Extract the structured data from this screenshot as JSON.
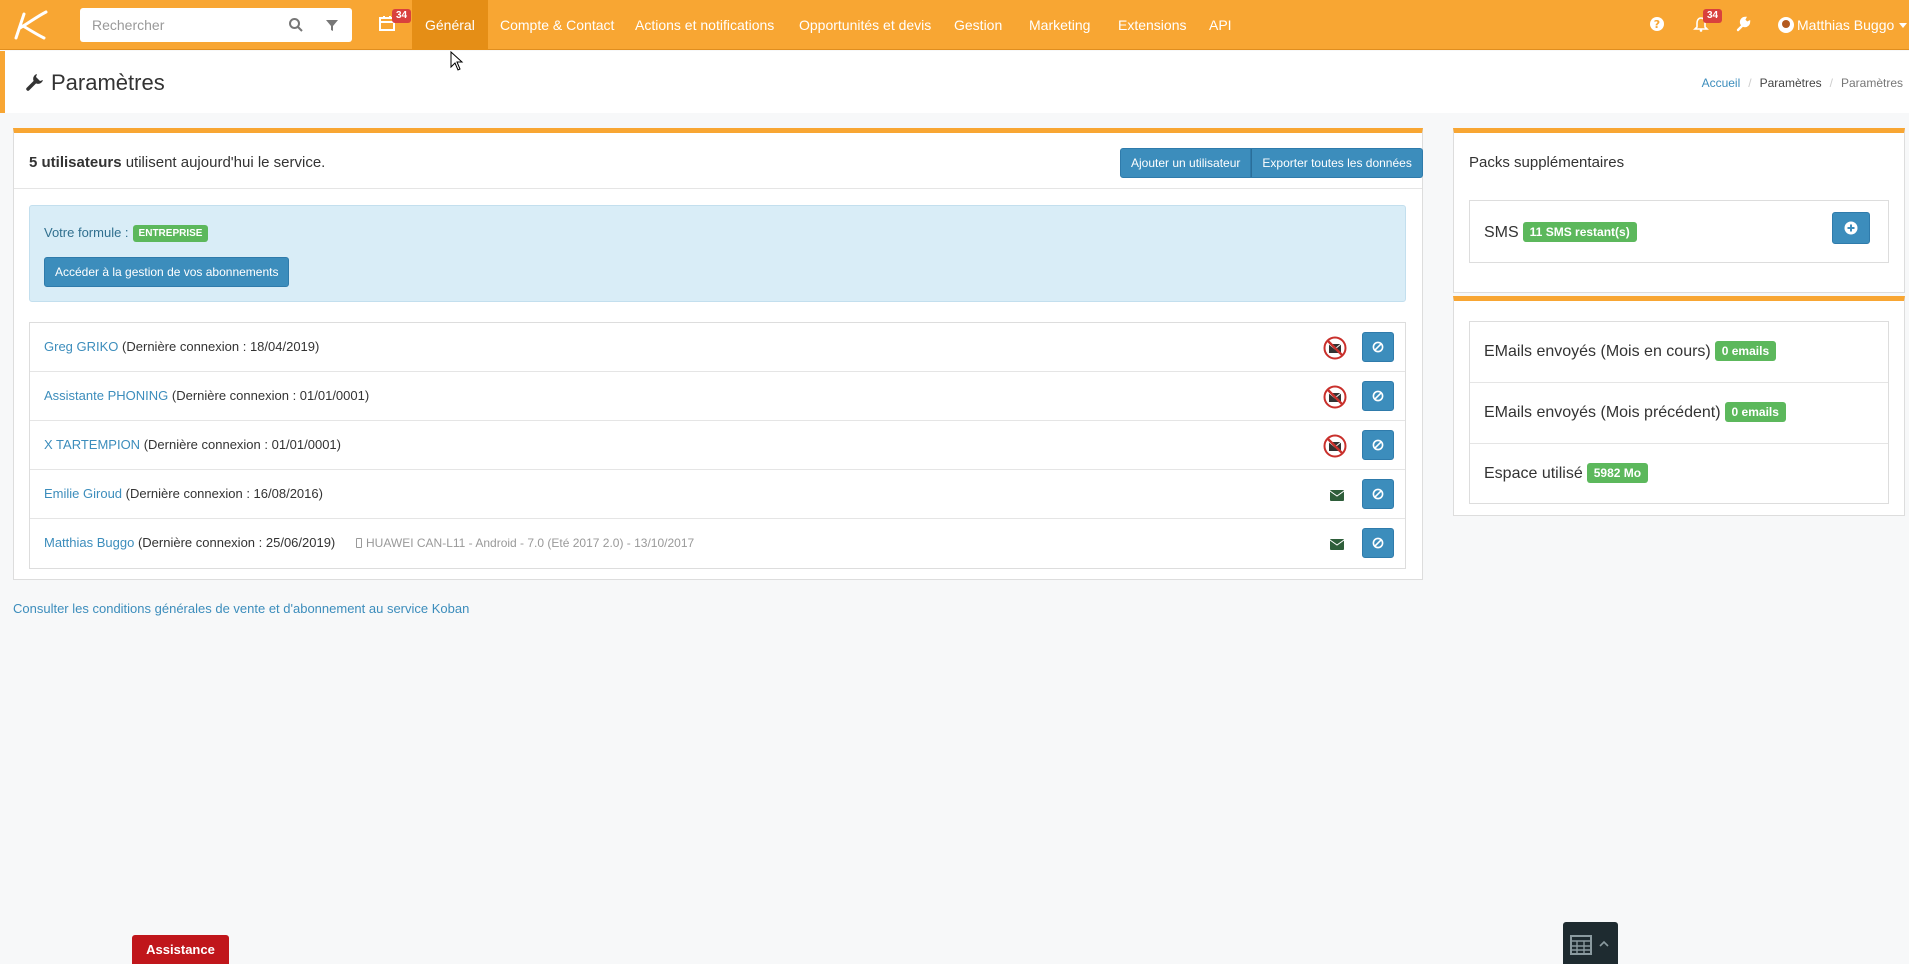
{
  "search": {
    "placeholder": "Rechercher"
  },
  "nav": {
    "calendar_badge": "34",
    "items": [
      "Général",
      "Compte & Contact",
      "Actions et notifications",
      "Opportunités et devis",
      "Gestion",
      "Marketing",
      "Extensions",
      "API"
    ],
    "notifications_badge": "34",
    "user_name": "Matthias Buggo"
  },
  "page": {
    "title": "Paramètres",
    "breadcrumb": [
      "Accueil",
      "Paramètres",
      "Paramètres"
    ]
  },
  "users_panel": {
    "count_bold": "5 utilisateurs",
    "count_rest": " utilisent aujourd'hui le service.",
    "add_user_label": "Ajouter un utilisateur",
    "export_label": "Exporter toutes les données",
    "formule_label": "Votre formule :",
    "formule_value": "ENTREPRISE",
    "subscriptions_label": "Accéder à la gestion de vos abonnements",
    "users": [
      {
        "name": "Greg GRIKO",
        "last_login": "(Dernière connexion : 18/04/2019)",
        "device": "",
        "mail_status": "disabled"
      },
      {
        "name": "Assistante PHONING",
        "last_login": "(Dernière connexion : 01/01/0001)",
        "device": "",
        "mail_status": "disabled"
      },
      {
        "name": "X TARTEMPION",
        "last_login": "(Dernière connexion : 01/01/0001)",
        "device": "",
        "mail_status": "disabled"
      },
      {
        "name": "Emilie Giroud",
        "last_login": "(Dernière connexion : 16/08/2016)",
        "device": "",
        "mail_status": "enabled"
      },
      {
        "name": "Matthias Buggo",
        "last_login": "(Dernière connexion : 25/06/2019)",
        "device": "HUAWEI CAN-L11 - Android - 7.0 (Eté 2017 2.0) - 13/10/2017",
        "mail_status": "enabled"
      }
    ]
  },
  "cgv_link": "Consulter les conditions générales de vente et d'abonnement au service Koban",
  "packs_panel": {
    "title": "Packs supplémentaires",
    "sms_label": "SMS",
    "sms_badge": "11 SMS restant(s)"
  },
  "stats_panel": {
    "rows": [
      {
        "label": "EMails envoyés (Mois en cours)",
        "badge": "0 emails"
      },
      {
        "label": "EMails envoyés (Mois précédent)",
        "badge": "0 emails"
      },
      {
        "label": "Espace utilisé",
        "badge": "5982 Mo"
      }
    ]
  },
  "assistance_label": "Assistance",
  "colors": {
    "brand": "#f8a633",
    "primary": "#3c8dbc",
    "success": "#5cb85c",
    "danger": "#d9413d"
  }
}
